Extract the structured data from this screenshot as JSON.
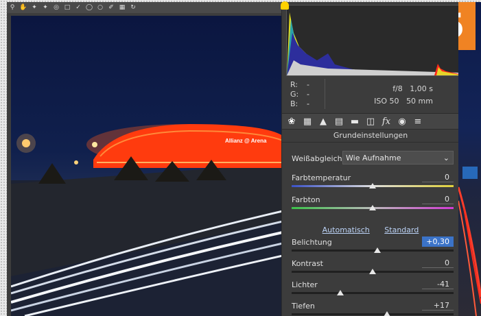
{
  "toolbar": {
    "tools": [
      "zoom-icon",
      "hand-icon",
      "white-balance-icon",
      "color-sampler-icon",
      "target-adjust-icon",
      "crop-icon",
      "straighten-icon",
      "spot-removal-icon",
      "red-eye-icon",
      "brush-icon",
      "filter-icon",
      "rotate-icon"
    ]
  },
  "photo": {
    "banner_text": "Allianz @ Arena"
  },
  "step_badge": "5",
  "info": {
    "r_label": "R:",
    "r_value": "---",
    "g_label": "G:",
    "g_value": "---",
    "b_label": "B:",
    "b_value": "---",
    "aperture": "f/8",
    "shutter": "1,00 s",
    "iso": "ISO 50",
    "focal": "50 mm"
  },
  "panel": {
    "section_title": "Grundeinstellungen",
    "white_balance": {
      "label": "Weißabgleich:",
      "value": "Wie Aufnahme"
    },
    "links": {
      "auto": "Automatisch",
      "default": "Standard"
    },
    "sliders": [
      {
        "key": "farbtemperatur",
        "label": "Farbtemperatur",
        "value": "0",
        "pos": 0.5,
        "gradient": "linear-gradient(90deg,#3b52c8,#ddd,#e0d13a)"
      },
      {
        "key": "farbton",
        "label": "Farbton",
        "value": "0",
        "pos": 0.5,
        "gradient": "linear-gradient(90deg,#3cc24a,#bbb,#d23bd4)"
      },
      {
        "key": "belichtung",
        "label": "Belichtung",
        "value": "+0,30",
        "pos": 0.53,
        "highlight": true
      },
      {
        "key": "kontrast",
        "label": "Kontrast",
        "value": "0",
        "pos": 0.5
      },
      {
        "key": "lichter",
        "label": "Lichter",
        "value": "-41",
        "pos": 0.3
      },
      {
        "key": "tiefen",
        "label": "Tiefen",
        "value": "+17",
        "pos": 0.59
      }
    ]
  },
  "colors": {
    "accent": "#f08323",
    "selected": "#3b73c8",
    "panel": "#3c3c3c"
  }
}
